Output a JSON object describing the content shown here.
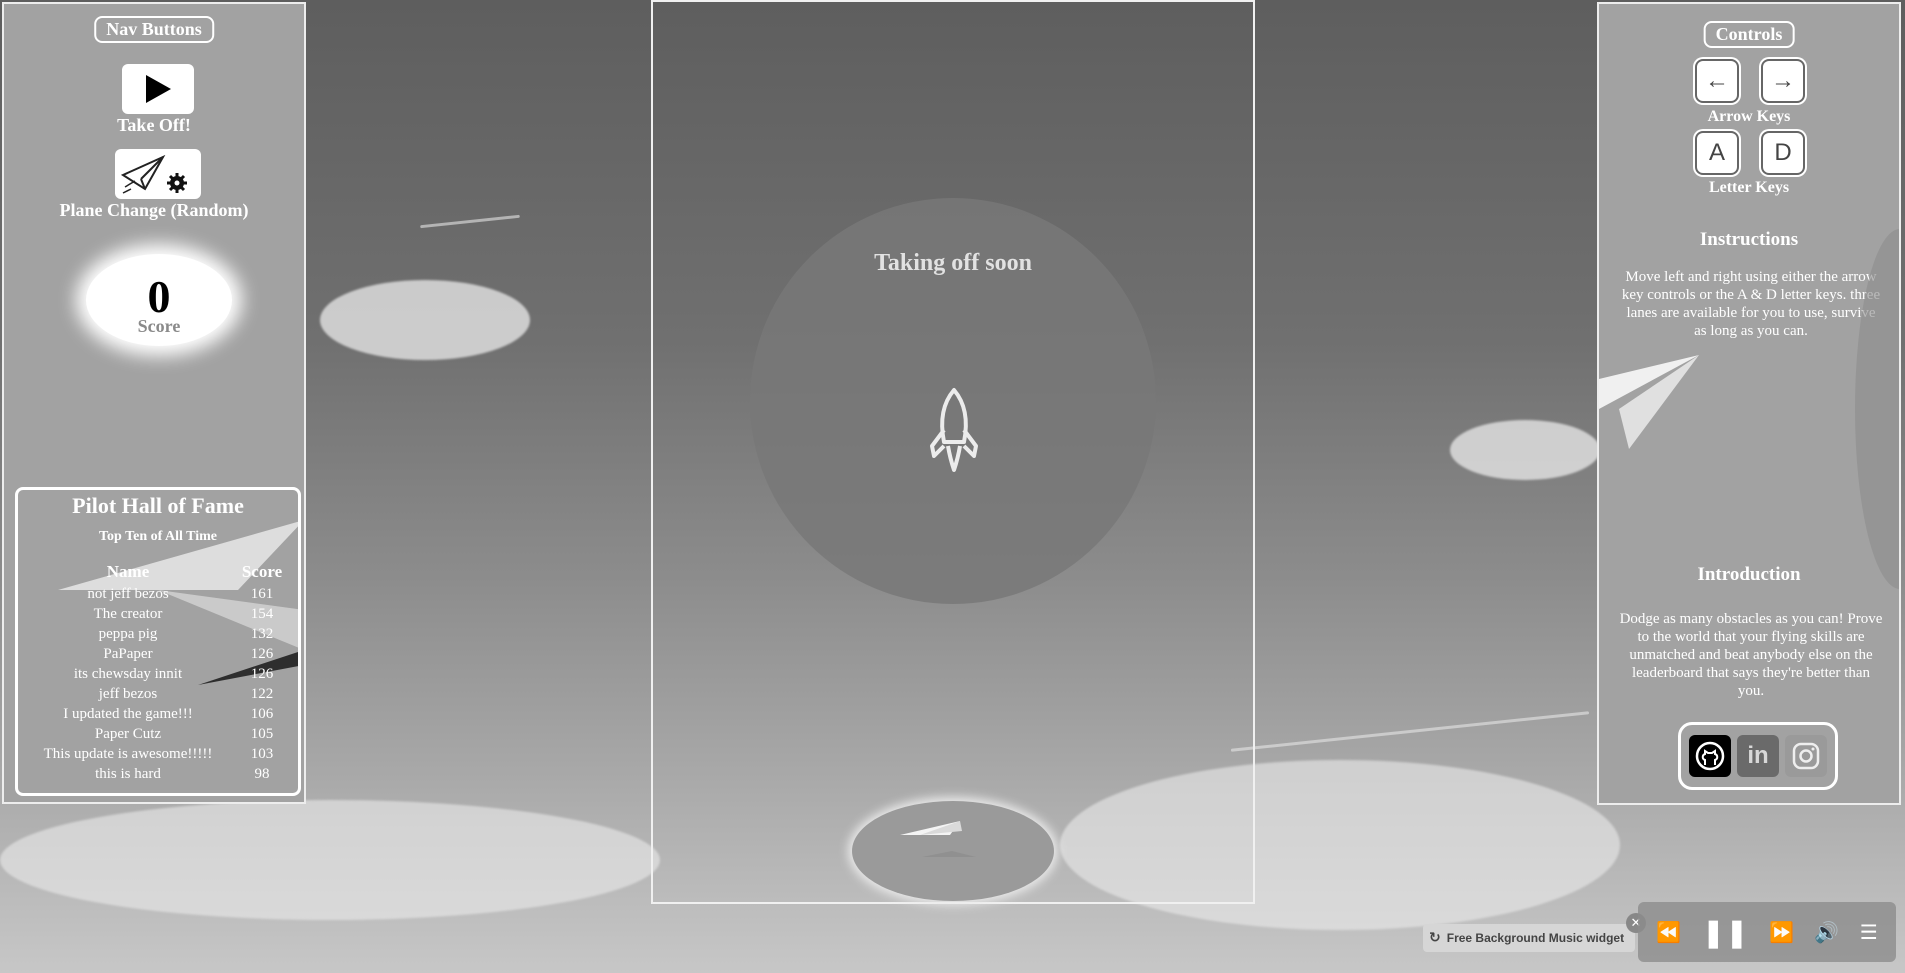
{
  "left_panel": {
    "nav_title": "Nav Buttons",
    "takeoff_label": "Take Off!",
    "plane_change_label": "Plane Change (Random)",
    "score": {
      "value": "0",
      "label": "Score"
    },
    "hall_of_fame": {
      "title": "Pilot Hall of Fame",
      "subtitle": "Top Ten of All Time",
      "headers": {
        "name": "Name",
        "score": "Score"
      },
      "rows": [
        {
          "name": "not jeff bezos",
          "score": "161"
        },
        {
          "name": "The creator",
          "score": "154"
        },
        {
          "name": "peppa pig",
          "score": "132"
        },
        {
          "name": "PaPaper",
          "score": "126"
        },
        {
          "name": "its chewsday innit",
          "score": "126"
        },
        {
          "name": "jeff bezos",
          "score": "122"
        },
        {
          "name": "I updated the game!!!",
          "score": "106"
        },
        {
          "name": "Paper Cutz",
          "score": "105"
        },
        {
          "name": "This update is awesome!!!!!",
          "score": "103"
        },
        {
          "name": "this is hard",
          "score": "98"
        }
      ]
    }
  },
  "game": {
    "status_text": "Taking off soon",
    "icons": {
      "status": "rocket-icon",
      "player": "paper-plane-icon"
    }
  },
  "right_panel": {
    "controls_title": "Controls",
    "arrow_keys": {
      "left": "←",
      "right": "→",
      "label": "Arrow Keys"
    },
    "letter_keys": {
      "left": "A",
      "right": "D",
      "label": "Letter Keys"
    },
    "instructions": {
      "title": "Instructions",
      "text": "Move left and right using either the arrow key controls or the A & D letter keys. three lanes are available for you to use, survive as long as you can."
    },
    "introduction": {
      "title": "Introduction",
      "text": "Dodge as many obstacles as you can! Prove to the world that your flying skills are unmatched and beat anybody else on the leaderboard that says they're better than you."
    },
    "social_icons": [
      "github-icon",
      "linkedin-icon",
      "instagram-icon"
    ]
  },
  "music_widget": {
    "label": "Free Background Music widget",
    "icons": [
      "close-icon",
      "rewind-icon",
      "pause-icon",
      "fast-forward-icon",
      "volume-icon",
      "playlist-icon"
    ]
  }
}
